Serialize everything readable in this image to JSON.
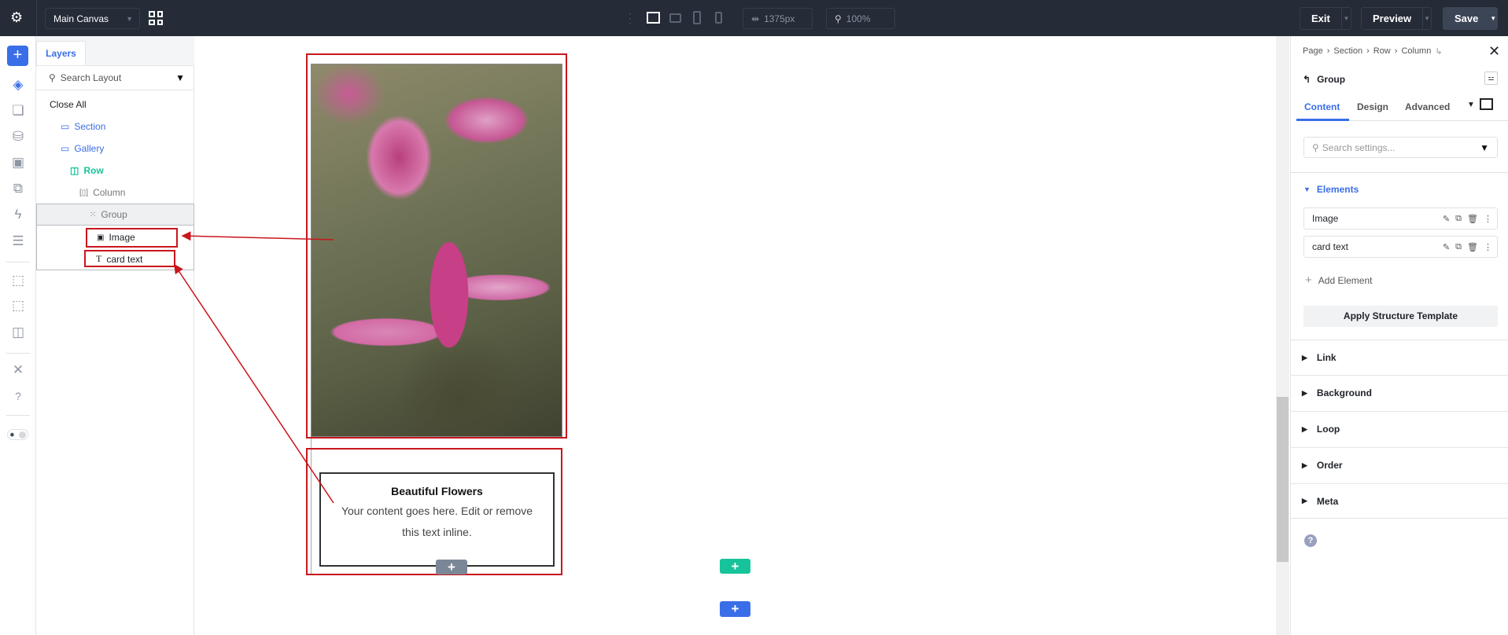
{
  "topbar": {
    "canvas_select": "Main Canvas",
    "width_value": "1375px",
    "zoom_value": "100%",
    "exit_label": "Exit",
    "preview_label": "Preview",
    "save_label": "Save"
  },
  "layers": {
    "tab_label": "Layers",
    "search_placeholder": "Search Layout",
    "close_all": "Close All",
    "items": [
      {
        "label": "Section"
      },
      {
        "label": "Gallery"
      },
      {
        "label": "Row"
      },
      {
        "label": "Column"
      },
      {
        "label": "Group"
      },
      {
        "label": "Image"
      },
      {
        "label": "card text"
      }
    ]
  },
  "canvas": {
    "card_title": "Beautiful Flowers",
    "card_body": "Your content goes here. Edit or remove this text inline."
  },
  "panel": {
    "breadcrumb": [
      "Page",
      "Section",
      "Row",
      "Column"
    ],
    "element_title": "Group",
    "tabs": [
      "Content",
      "Design",
      "Advanced"
    ],
    "search_placeholder": "Search settings...",
    "elements_heading": "Elements",
    "elements": [
      "Image",
      "card text"
    ],
    "add_element": "Add Element",
    "apply_template": "Apply Structure Template",
    "sections": [
      "Link",
      "Background",
      "Loop",
      "Order",
      "Meta"
    ]
  },
  "colors": {
    "accent": "#3a6ee8",
    "row_green": "#17c39a",
    "highlight_red": "#c8161d",
    "topbar": "#252b37"
  }
}
